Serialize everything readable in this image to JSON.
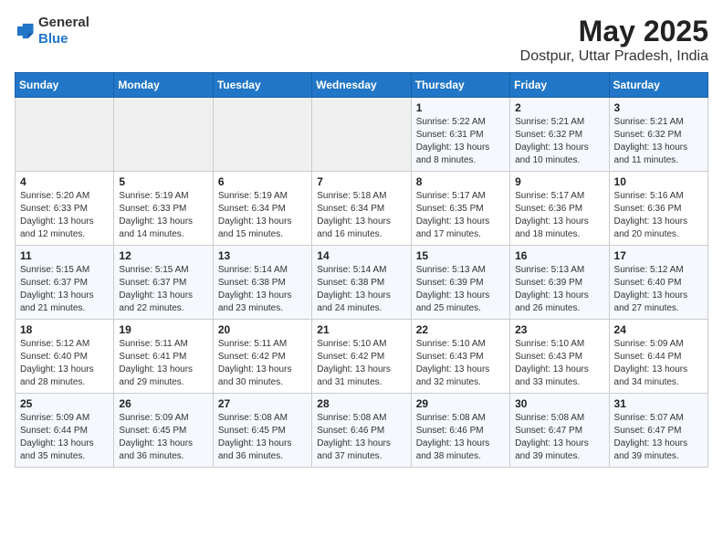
{
  "logo": {
    "general": "General",
    "blue": "Blue"
  },
  "header": {
    "month_year": "May 2025",
    "location": "Dostpur, Uttar Pradesh, India"
  },
  "weekdays": [
    "Sunday",
    "Monday",
    "Tuesday",
    "Wednesday",
    "Thursday",
    "Friday",
    "Saturday"
  ],
  "weeks": [
    [
      {
        "day": "",
        "info": ""
      },
      {
        "day": "",
        "info": ""
      },
      {
        "day": "",
        "info": ""
      },
      {
        "day": "",
        "info": ""
      },
      {
        "day": "1",
        "info": "Sunrise: 5:22 AM\nSunset: 6:31 PM\nDaylight: 13 hours\nand 8 minutes."
      },
      {
        "day": "2",
        "info": "Sunrise: 5:21 AM\nSunset: 6:32 PM\nDaylight: 13 hours\nand 10 minutes."
      },
      {
        "day": "3",
        "info": "Sunrise: 5:21 AM\nSunset: 6:32 PM\nDaylight: 13 hours\nand 11 minutes."
      }
    ],
    [
      {
        "day": "4",
        "info": "Sunrise: 5:20 AM\nSunset: 6:33 PM\nDaylight: 13 hours\nand 12 minutes."
      },
      {
        "day": "5",
        "info": "Sunrise: 5:19 AM\nSunset: 6:33 PM\nDaylight: 13 hours\nand 14 minutes."
      },
      {
        "day": "6",
        "info": "Sunrise: 5:19 AM\nSunset: 6:34 PM\nDaylight: 13 hours\nand 15 minutes."
      },
      {
        "day": "7",
        "info": "Sunrise: 5:18 AM\nSunset: 6:34 PM\nDaylight: 13 hours\nand 16 minutes."
      },
      {
        "day": "8",
        "info": "Sunrise: 5:17 AM\nSunset: 6:35 PM\nDaylight: 13 hours\nand 17 minutes."
      },
      {
        "day": "9",
        "info": "Sunrise: 5:17 AM\nSunset: 6:36 PM\nDaylight: 13 hours\nand 18 minutes."
      },
      {
        "day": "10",
        "info": "Sunrise: 5:16 AM\nSunset: 6:36 PM\nDaylight: 13 hours\nand 20 minutes."
      }
    ],
    [
      {
        "day": "11",
        "info": "Sunrise: 5:15 AM\nSunset: 6:37 PM\nDaylight: 13 hours\nand 21 minutes."
      },
      {
        "day": "12",
        "info": "Sunrise: 5:15 AM\nSunset: 6:37 PM\nDaylight: 13 hours\nand 22 minutes."
      },
      {
        "day": "13",
        "info": "Sunrise: 5:14 AM\nSunset: 6:38 PM\nDaylight: 13 hours\nand 23 minutes."
      },
      {
        "day": "14",
        "info": "Sunrise: 5:14 AM\nSunset: 6:38 PM\nDaylight: 13 hours\nand 24 minutes."
      },
      {
        "day": "15",
        "info": "Sunrise: 5:13 AM\nSunset: 6:39 PM\nDaylight: 13 hours\nand 25 minutes."
      },
      {
        "day": "16",
        "info": "Sunrise: 5:13 AM\nSunset: 6:39 PM\nDaylight: 13 hours\nand 26 minutes."
      },
      {
        "day": "17",
        "info": "Sunrise: 5:12 AM\nSunset: 6:40 PM\nDaylight: 13 hours\nand 27 minutes."
      }
    ],
    [
      {
        "day": "18",
        "info": "Sunrise: 5:12 AM\nSunset: 6:40 PM\nDaylight: 13 hours\nand 28 minutes."
      },
      {
        "day": "19",
        "info": "Sunrise: 5:11 AM\nSunset: 6:41 PM\nDaylight: 13 hours\nand 29 minutes."
      },
      {
        "day": "20",
        "info": "Sunrise: 5:11 AM\nSunset: 6:42 PM\nDaylight: 13 hours\nand 30 minutes."
      },
      {
        "day": "21",
        "info": "Sunrise: 5:10 AM\nSunset: 6:42 PM\nDaylight: 13 hours\nand 31 minutes."
      },
      {
        "day": "22",
        "info": "Sunrise: 5:10 AM\nSunset: 6:43 PM\nDaylight: 13 hours\nand 32 minutes."
      },
      {
        "day": "23",
        "info": "Sunrise: 5:10 AM\nSunset: 6:43 PM\nDaylight: 13 hours\nand 33 minutes."
      },
      {
        "day": "24",
        "info": "Sunrise: 5:09 AM\nSunset: 6:44 PM\nDaylight: 13 hours\nand 34 minutes."
      }
    ],
    [
      {
        "day": "25",
        "info": "Sunrise: 5:09 AM\nSunset: 6:44 PM\nDaylight: 13 hours\nand 35 minutes."
      },
      {
        "day": "26",
        "info": "Sunrise: 5:09 AM\nSunset: 6:45 PM\nDaylight: 13 hours\nand 36 minutes."
      },
      {
        "day": "27",
        "info": "Sunrise: 5:08 AM\nSunset: 6:45 PM\nDaylight: 13 hours\nand 36 minutes."
      },
      {
        "day": "28",
        "info": "Sunrise: 5:08 AM\nSunset: 6:46 PM\nDaylight: 13 hours\nand 37 minutes."
      },
      {
        "day": "29",
        "info": "Sunrise: 5:08 AM\nSunset: 6:46 PM\nDaylight: 13 hours\nand 38 minutes."
      },
      {
        "day": "30",
        "info": "Sunrise: 5:08 AM\nSunset: 6:47 PM\nDaylight: 13 hours\nand 39 minutes."
      },
      {
        "day": "31",
        "info": "Sunrise: 5:07 AM\nSunset: 6:47 PM\nDaylight: 13 hours\nand 39 minutes."
      }
    ]
  ]
}
